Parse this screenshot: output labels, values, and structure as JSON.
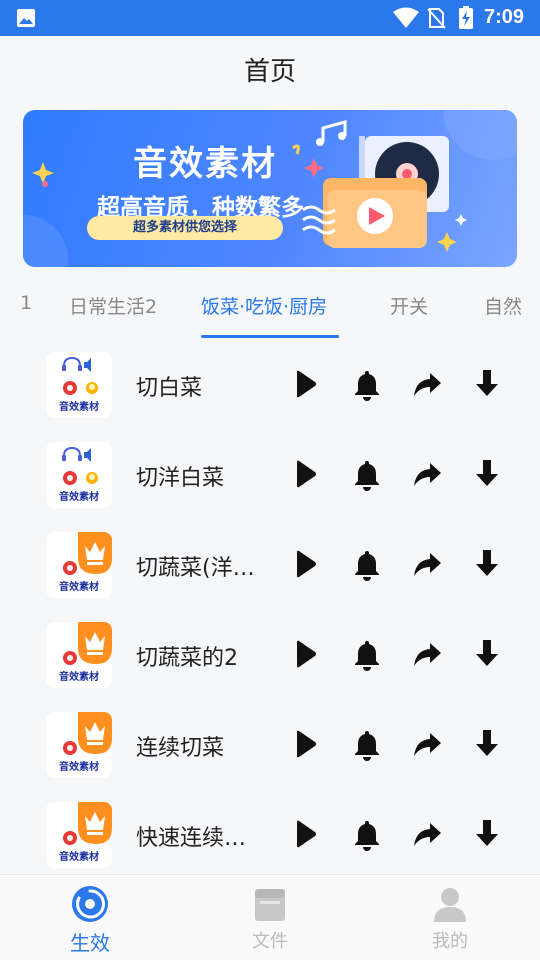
{
  "status_bar": {
    "time": "7:09"
  },
  "header": {
    "title": "首页"
  },
  "banner": {
    "title": "音效素材",
    "subtitle": "超高音质，种数繁多",
    "pill": "超多素材供您选择"
  },
  "tabs": [
    {
      "label": "1"
    },
    {
      "label": "日常生活2"
    },
    {
      "label": "饭菜·吃饭·厨房"
    },
    {
      "label": "开关"
    },
    {
      "label": "自然"
    }
  ],
  "active_tab_index": 2,
  "thumb_text": "音效素材",
  "sounds": [
    {
      "title": "切白菜",
      "premium": false
    },
    {
      "title": "切洋白菜",
      "premium": false
    },
    {
      "title": "切蔬菜(洋…",
      "premium": true
    },
    {
      "title": "切蔬菜的2",
      "premium": true
    },
    {
      "title": "连续切菜",
      "premium": true
    },
    {
      "title": "快速连续…",
      "premium": true
    }
  ],
  "bottom_nav": [
    {
      "label": "生效",
      "icon": "disc-icon",
      "active": true
    },
    {
      "label": "文件",
      "icon": "folder-icon",
      "active": false
    },
    {
      "label": "我的",
      "icon": "person-icon",
      "active": false
    }
  ],
  "colors": {
    "primary": "#2a78ea",
    "premium_badge": "#ff8f1f"
  }
}
